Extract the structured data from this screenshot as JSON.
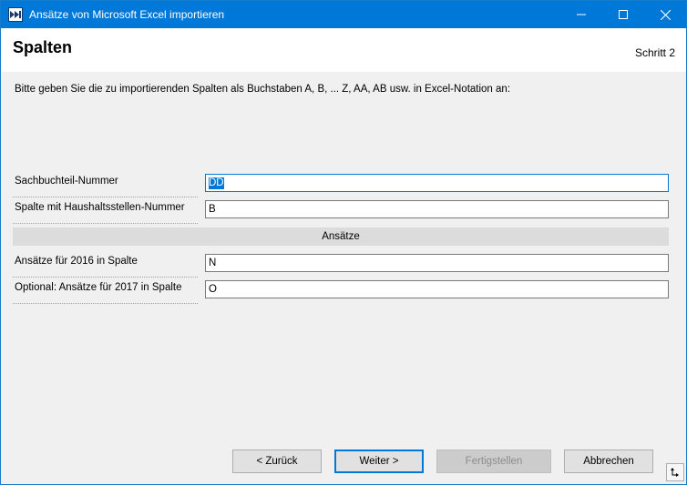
{
  "window": {
    "title": "Ansätze von Microsoft Excel importieren"
  },
  "header": {
    "title": "Spalten",
    "step": "Schritt 2"
  },
  "instruction": "Bitte geben Sie die zu importierenden Spalten als Buchstaben A, B, ... Z, AA, AB usw. in Excel-Notation an:",
  "fields": [
    {
      "label": "Sachbuchteil-Nummer",
      "value": "DD"
    },
    {
      "label": "Spalte mit Haushaltsstellen-Nummer",
      "value": "B"
    },
    {
      "label": "Ansätze für 2016 in Spalte",
      "value": "N"
    },
    {
      "label": "Optional: Ansätze für 2017 in Spalte",
      "value": "O"
    }
  ],
  "section": {
    "title": "Ansätze"
  },
  "buttons": {
    "back": "< Zurück",
    "next": "Weiter >",
    "finish": "Fertigstellen",
    "cancel": "Abbrechen"
  },
  "colors": {
    "accent": "#0078d7",
    "titlebar": "#0078d7",
    "dialog_background": "#f0f0f0"
  },
  "icons": {
    "app": "double-arrow-icon",
    "minimize": "minimize-icon",
    "maximize": "maximize-icon",
    "close": "close-icon",
    "corner": "resize-corner-icon"
  }
}
